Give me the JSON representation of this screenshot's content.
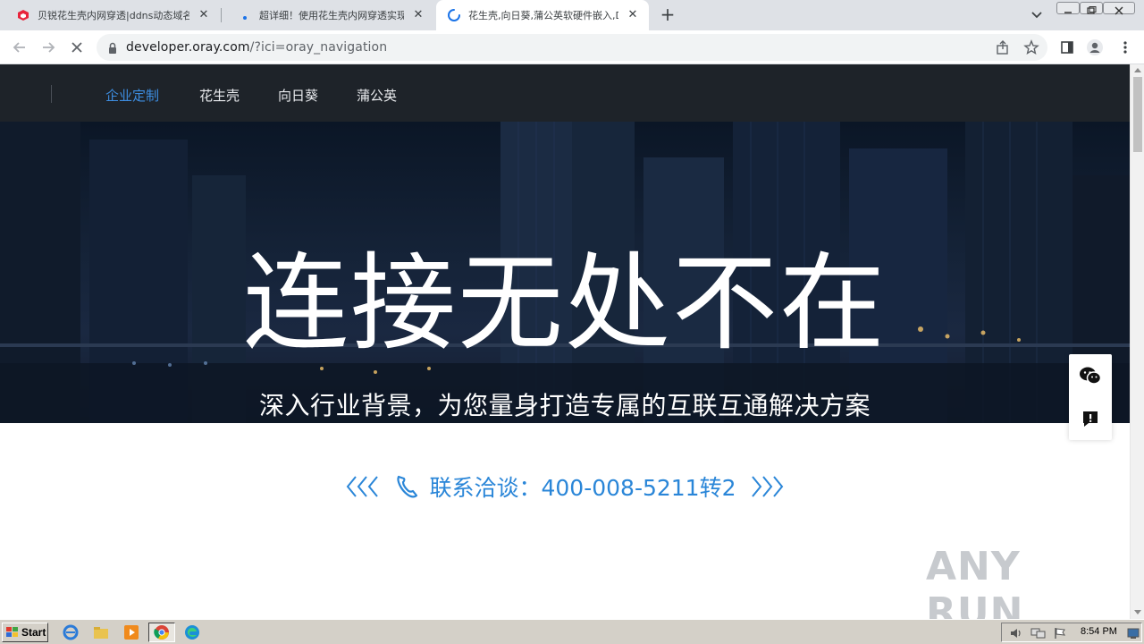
{
  "browser": {
    "tabs": [
      {
        "title": "贝锐花生壳内网穿透|ddns动态域名",
        "state": "inactive",
        "favicon": "oray-red-cube-icon"
      },
      {
        "title": "超详细！使用花生壳内网穿透实现外",
        "state": "inactive",
        "favicon": "blue-dot-favicon"
      },
      {
        "title": "花生壳,向日葵,蒲公英软硬件嵌入,DI",
        "state": "active",
        "favicon": "loading-spinner-icon"
      }
    ],
    "new_tab_label": "+",
    "close_glyph": "✕",
    "url_host": "developer.oray.com",
    "url_path": "/?ici=oray_navigation"
  },
  "site": {
    "nav": {
      "items": [
        {
          "label": "企业定制",
          "active": true
        },
        {
          "label": "花生壳",
          "active": false
        },
        {
          "label": "向日葵",
          "active": false
        },
        {
          "label": "蒲公英",
          "active": false
        }
      ]
    },
    "hero": {
      "headline": "连接无处不在",
      "subline": "深入行业背景，为您量身打造专属的互联互通解决方案"
    },
    "contact": {
      "text": "联系洽谈：400-008-5211转2"
    },
    "colors": {
      "accent": "#2a86d8",
      "nav_bg": "#1e2329",
      "nav_active": "#3d8de0"
    }
  },
  "watermark": {
    "text": "ANY RUN"
  },
  "taskbar": {
    "start_label": "Start",
    "clock": "8:54 PM",
    "quick_launch": [
      "ie-icon",
      "explorer-folder-icon",
      "media-player-icon",
      "chrome-icon",
      "edge-icon"
    ]
  }
}
